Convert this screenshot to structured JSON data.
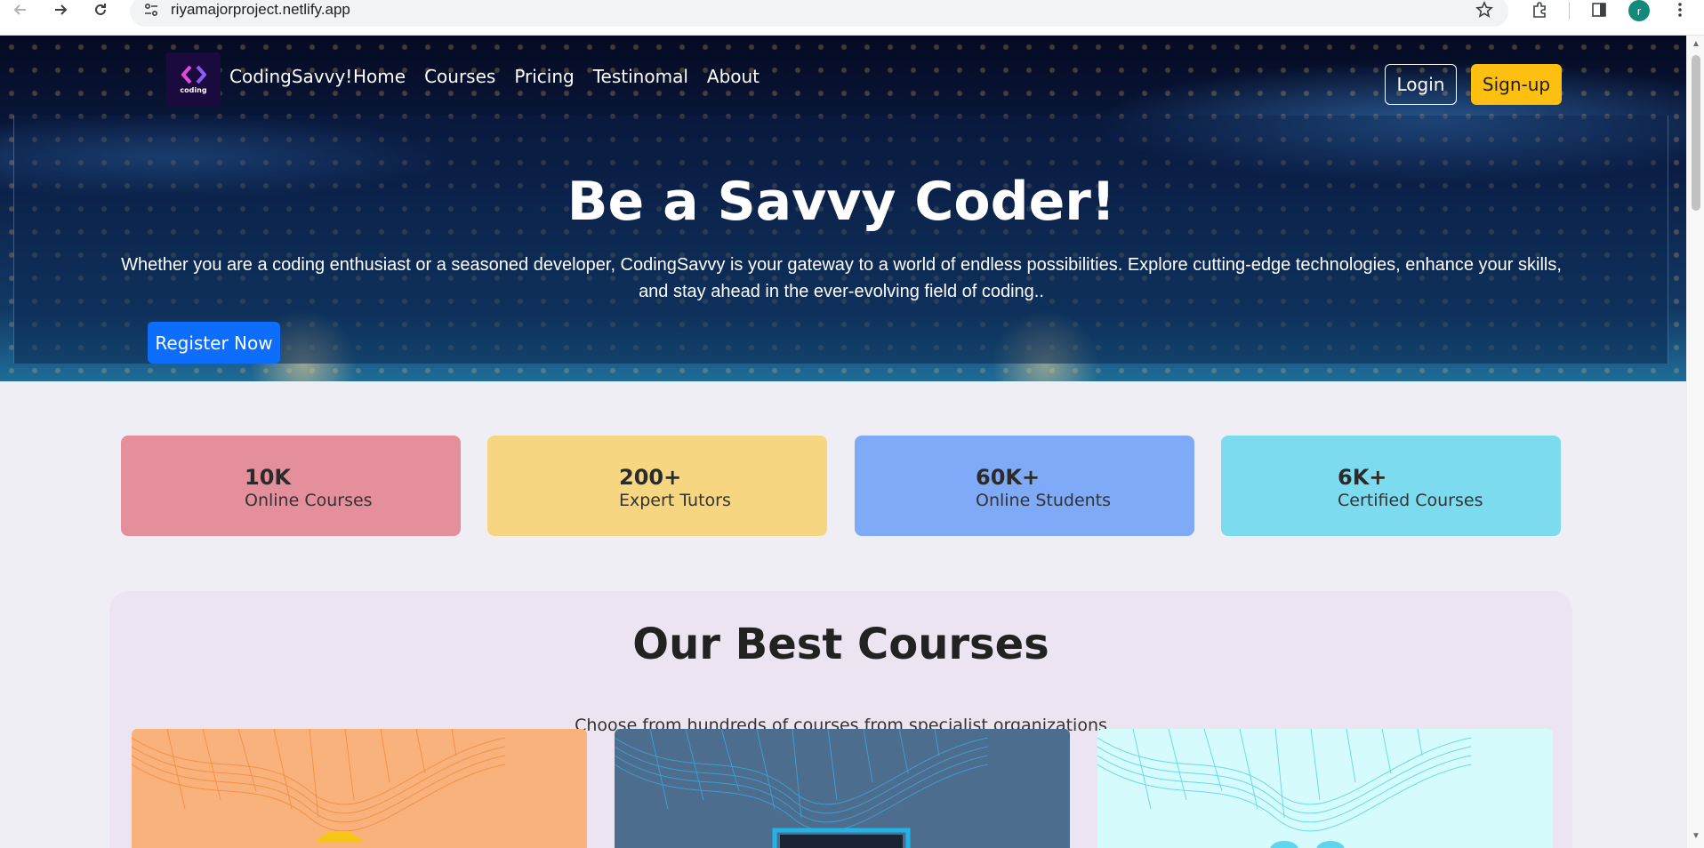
{
  "browser": {
    "url": "riyamajorproject.netlify.app",
    "profile_initial": "r",
    "icons": [
      "back-icon",
      "forward-icon",
      "reload-icon",
      "site-settings-icon",
      "bookmark-star-icon",
      "extensions-icon",
      "side-panel-icon",
      "menu-kebab-icon"
    ]
  },
  "nav": {
    "logo_text": "coding",
    "brand": "CodingSavvy!",
    "links": [
      "Home",
      "Courses",
      "Pricing",
      "Testinomal",
      "About"
    ],
    "login_label": "Login",
    "signup_label": "Sign-up"
  },
  "hero": {
    "title": "Be a Savvy Coder!",
    "subtitle": "Whether you are a coding enthusiast or a seasoned developer, CodingSavvy is your gateway to a world of endless possibilities. Explore cutting-edge technologies, enhance your skills, and stay ahead in the ever-evolving field of coding..",
    "cta_label": "Register Now"
  },
  "stats": [
    {
      "value": "10K",
      "label": "Online Courses",
      "color": "#e48f9b"
    },
    {
      "value": "200+",
      "label": "Expert Tutors",
      "color": "#f6d680"
    },
    {
      "value": "60K+",
      "label": "Online Students",
      "color": "#7eaaf7"
    },
    {
      "value": "6K+",
      "label": "Certified Courses",
      "color": "#7ddbf0"
    }
  ],
  "courses": {
    "title": "Our Best Courses",
    "subtitle": "Choose from hundreds of courses from specialist organizations",
    "card_colors": [
      "#f9b27c",
      "#4c6d8d",
      "#d6fbfd"
    ]
  },
  "colors": {
    "accent_primary": "#0d6efd",
    "accent_signup": "#fdc010",
    "page_background": "#efeef5"
  }
}
